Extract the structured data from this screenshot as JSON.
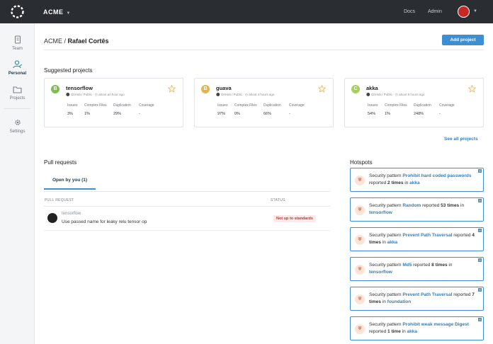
{
  "topbar": {
    "org": "ACME",
    "links": [
      "Docs",
      "Admin"
    ]
  },
  "sidebar": {
    "items": [
      {
        "label": "Team",
        "icon": "team-icon"
      },
      {
        "label": "Personal",
        "icon": "person-icon",
        "active": true
      },
      {
        "label": "Projects",
        "icon": "folder-icon"
      },
      {
        "label": "Settings",
        "icon": "gear-icon"
      }
    ]
  },
  "header": {
    "org": "ACME",
    "separator": " / ",
    "user": "Rafael Cortês",
    "add_project": "Add project"
  },
  "suggested": {
    "title": "Suggested projects",
    "see_all": "See all projects",
    "metric_labels": [
      "Issues",
      "Complex Files",
      "Duplication",
      "Coverage"
    ],
    "projects": [
      {
        "grade": "B",
        "color": "#7cbf4d",
        "name": "tensorflow",
        "source": "GitHub / Public",
        "time": "about an hour ago",
        "values": [
          "3%",
          "1%",
          "29%",
          "-"
        ]
      },
      {
        "grade": "B",
        "color": "#e8b44a",
        "name": "guava",
        "source": "GitHub / Public",
        "time": "about 4 hours ago",
        "values": [
          "97%",
          "0%",
          "66%",
          "-"
        ]
      },
      {
        "grade": "C",
        "color": "#a6d05a",
        "name": "akka",
        "source": "GitHub / Public",
        "time": "about 6 hours ago",
        "values": [
          "54%",
          "1%",
          "248%",
          "-"
        ]
      }
    ]
  },
  "pull_requests": {
    "title": "Pull requests",
    "tab": "Open by you (1)",
    "col_request": "PULL REQUEST",
    "col_status": "STATUS",
    "rows": [
      {
        "repo": "tensorflow",
        "title": "Use passed name for leaky relu tensor op",
        "status": "Not up to standards"
      }
    ]
  },
  "hotspots": {
    "title": "Hotspots",
    "items": [
      {
        "pre": "Security pattern ",
        "pattern": "Prohibit hard coded passwords",
        "mid": " reported ",
        "count": "2 times",
        "in": " in ",
        "repo": "akka"
      },
      {
        "pre": "Security pattern ",
        "pattern": "Random",
        "mid": " reported ",
        "count": "53 times",
        "in": " in ",
        "repo": "tensorflow"
      },
      {
        "pre": "Security pattern ",
        "pattern": "Prevent Path Traversal",
        "mid": " reported ",
        "count": "4 times",
        "in": " in ",
        "repo": "akka"
      },
      {
        "pre": "Security pattern ",
        "pattern": "Md5",
        "mid": " reported ",
        "count": "8 times",
        "in": " in ",
        "repo": "tensorflow"
      },
      {
        "pre": "Security pattern ",
        "pattern": "Prevent Path Traversal",
        "mid": " reported ",
        "count": "7 times",
        "in": " in ",
        "repo": "foundation"
      },
      {
        "pre": "Security pattern ",
        "pattern": "Prohibit weak message Digest",
        "mid": " reported ",
        "count": "1 time",
        "in": " in ",
        "repo": "akka"
      }
    ]
  }
}
